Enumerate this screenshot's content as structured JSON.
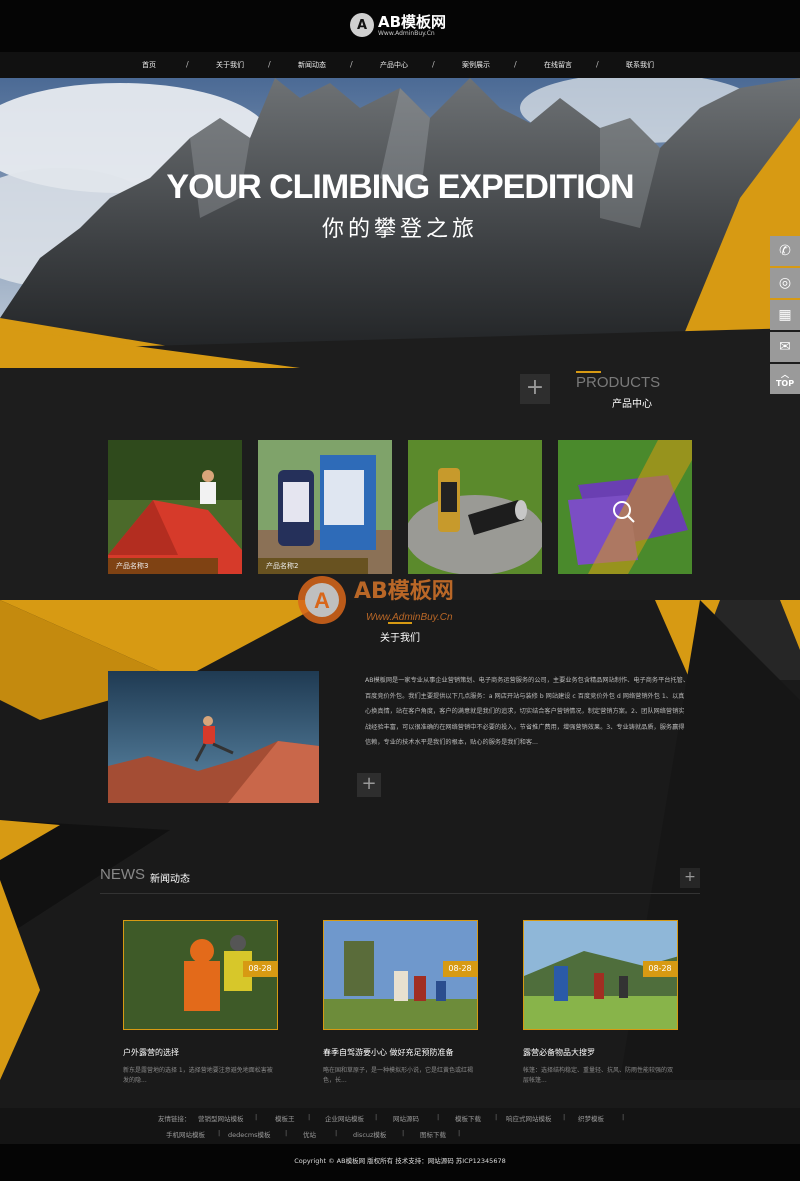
{
  "logo": {
    "mark": "A",
    "title": "AB模板网",
    "subtitle": "Www.AdminBuy.Cn"
  },
  "nav": [
    "首页",
    "关于我们",
    "新闻动态",
    "产品中心",
    "案例展示",
    "在线留言",
    "联系我们"
  ],
  "hero": {
    "title": "YOUR CLIMBING EXPEDITION",
    "subtitle": "你的攀登之旅"
  },
  "side": {
    "icons": [
      "phone-icon",
      "headset-icon",
      "qrcode-icon",
      "message-icon"
    ],
    "top_label": "TOP"
  },
  "products": {
    "title_en": "PRODUCTS",
    "title_cn": "产品中心",
    "more": "+",
    "items": [
      {
        "label": "产品名称3"
      },
      {
        "label": "产品名称2"
      },
      {
        "label": ""
      },
      {
        "label": ""
      }
    ]
  },
  "watermark": {
    "title": "AB模板网",
    "sub": "Www.AdminBuy.Cn"
  },
  "about": {
    "title": "关于我们",
    "more": "+",
    "text": "AB模板网是一家专业从事企业营销策划、电子商务运营服务的公司，主要业务包含精品网站制作、电子商务平台托管、百度竞价外包。我们主要提供以下几点服务：a 网店开站与装修 b 网站建设 c 百度竞价外包 d 网络营销外包 1、以真心换真情，站在客户角度，客户的满意就是我们的追求，切实结合客户营销情况，制定营销方案。2、团队网络营销实战经验丰富，可以很准确的在网络营销中不必要的投入，节省推广费用，增强营销效果。3、专业铸就品质，服务赢得信赖，专业的技术水平是我们的根本，贴心的服务是我们和客..."
  },
  "news": {
    "title_en": "NEWS",
    "title_cn": "新闻动态",
    "more": "+",
    "items": [
      {
        "date": "08-28",
        "title": "户外露营的选择",
        "desc": "新东是露营地的选择 1，选择营地要注意避免地面松害被发的隐..."
      },
      {
        "date": "08-28",
        "title": "春季自驾游要小心 做好充足预防准备",
        "desc": "略在国和草原子，是一种模拟形小说，它是红黄色或红褐色，长..."
      },
      {
        "date": "08-28",
        "title": "露营必备物品大搜罗",
        "desc": "帐篷：选择结构稳定、重量轻、抗风、防雨性能较强的双层帐篷..."
      }
    ]
  },
  "links": {
    "label": "友情链接：",
    "row1": [
      "营销型网站模板",
      "模板王",
      "企业网站模板",
      "网站源码",
      "模板下载",
      "响应式网站模板",
      "织梦模板"
    ],
    "row2": [
      "手机网站模板",
      "dedecms模板",
      "优站",
      "discuz模板",
      "图标下载"
    ]
  },
  "footer": {
    "copyright": "Copyright © AB模板网 版权所有 技术支持：网站源码 苏ICP12345678"
  },
  "colors": {
    "accent": "#d79a13",
    "dark": "#1c1c1c"
  }
}
